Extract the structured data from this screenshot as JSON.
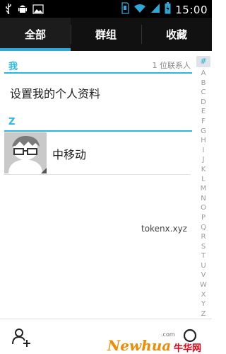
{
  "status_bar": {
    "time": "15:00",
    "left_icons": [
      "usb-icon",
      "android-debug-icon",
      "image-notification-icon"
    ],
    "right_icons": [
      "sd-card-icon",
      "wifi-icon",
      "signal-icon",
      "battery-icon"
    ]
  },
  "tabs": [
    {
      "label": "全部",
      "active": true
    },
    {
      "label": "群组",
      "active": false
    },
    {
      "label": "收藏",
      "active": false
    }
  ],
  "sections": [
    {
      "letter": "我",
      "count": "1 位联系人"
    },
    {
      "letter": "Z"
    }
  ],
  "my_profile": "设置我的个人资料",
  "contacts": [
    {
      "name": "中移动"
    }
  ],
  "watermark": "tokenx.xyz",
  "alpha_index": {
    "hash": "#",
    "letters": [
      "A",
      "B",
      "C",
      "D",
      "E",
      "F",
      "G",
      "H",
      "I",
      "J",
      "K",
      "L",
      "M",
      "N",
      "O",
      "P",
      "Q",
      "R",
      "S",
      "T",
      "U",
      "V",
      "W",
      "X",
      "Y",
      "Z"
    ]
  },
  "bottom_bar": {
    "add_contact_icon": "add-contact-icon",
    "search_icon": "search-icon"
  },
  "logo": {
    "text": "Newhua",
    "com": ".com",
    "cn": "牛华网"
  },
  "colors": {
    "accent": "#2fa7d6",
    "section_line": "#29b8e6",
    "logo_orange": "#f08a00",
    "logo_red": "#e60012"
  }
}
